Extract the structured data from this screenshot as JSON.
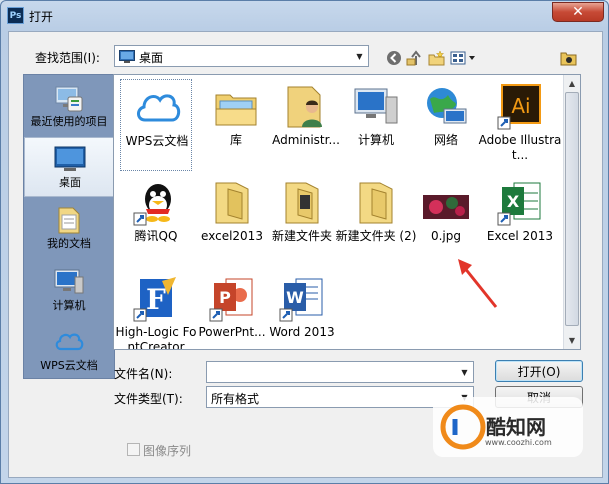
{
  "window": {
    "title": "打开",
    "app_icon_text": "Ps",
    "close_glyph": "✕"
  },
  "toolbar": {
    "look_in_label": "查找范围(I):",
    "look_in_value": "桌面"
  },
  "places": [
    {
      "label": "最近使用的项目",
      "icon": "recent-items-icon"
    },
    {
      "label": "桌面",
      "icon": "desktop-icon",
      "selected": true
    },
    {
      "label": "我的文档",
      "icon": "documents-icon"
    },
    {
      "label": "计算机",
      "icon": "computer-icon"
    },
    {
      "label": "WPS云文档",
      "icon": "cloud-icon"
    }
  ],
  "files": [
    {
      "name": "WPS云文档",
      "icon": "cloud-icon",
      "selected": true
    },
    {
      "name": "库",
      "icon": "library-icon"
    },
    {
      "name": "Administr...",
      "icon": "user-folder-icon"
    },
    {
      "name": "计算机",
      "icon": "computer-icon"
    },
    {
      "name": "网络",
      "icon": "network-icon"
    },
    {
      "name": "Adobe Illustrat...",
      "icon": "illustrator-icon"
    },
    {
      "name": "腾讯QQ",
      "icon": "qq-icon"
    },
    {
      "name": "excel2013",
      "icon": "folder-icon"
    },
    {
      "name": "新建文件夹",
      "icon": "folder-icon"
    },
    {
      "name": "新建文件夹 (2)",
      "icon": "folder-icon"
    },
    {
      "name": "0.jpg",
      "icon": "image-file-icon"
    },
    {
      "name": "Excel 2013",
      "icon": "excel-icon"
    },
    {
      "name": "High-Logic FontCreator",
      "icon": "fontcreator-icon"
    },
    {
      "name": "PowerPnt...",
      "icon": "powerpoint-icon"
    },
    {
      "name": "Word 2013",
      "icon": "word-icon"
    }
  ],
  "form": {
    "filename_label": "文件名(N):",
    "filename_value": "",
    "filetype_label": "文件类型(T):",
    "filetype_value": "所有格式",
    "open_button": "打开(O)",
    "cancel_button": "取消",
    "image_sequence_label": "图像序列",
    "image_sequence_checked": false
  },
  "watermark": {
    "brand": "酷知网",
    "url": "www.coozhi.com"
  }
}
